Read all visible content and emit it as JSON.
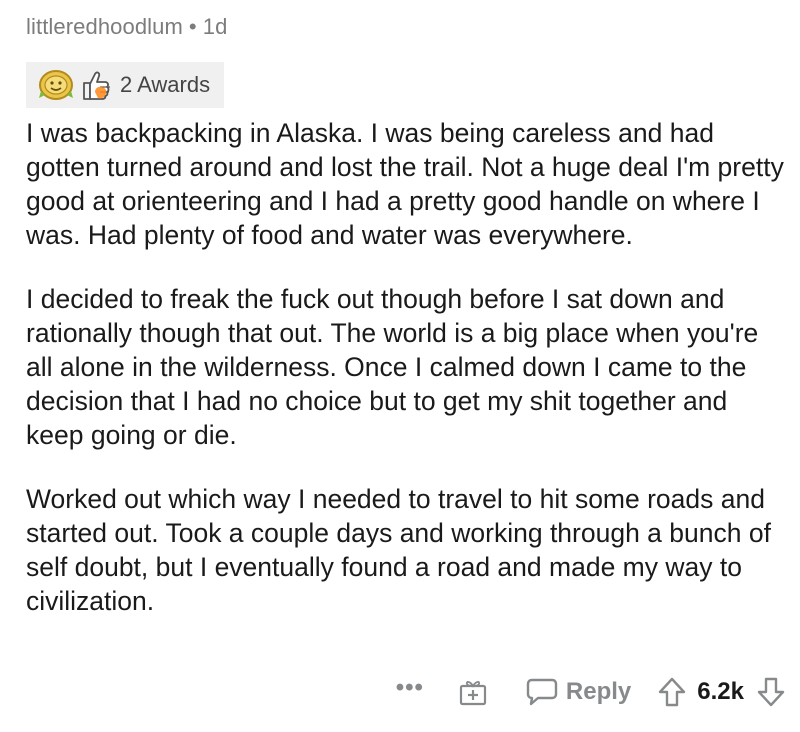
{
  "comment": {
    "username": "littleredhoodlum",
    "separator": "•",
    "age": "1d",
    "awards": {
      "count_label": "2 Awards",
      "icons": [
        "gold-coin-award-icon",
        "thumbs-up-award-icon"
      ]
    },
    "paragraphs": [
      "I was backpacking in Alaska. I was being careless and had gotten turned around and lost the trail. Not a huge deal I'm pretty good at orienteering and I had a pretty good handle on where I was. Had plenty of food and water was everywhere.",
      "I decided to freak the fuck out though before I sat down and rationally though that out. The world is a big place when you're all alone in the wilderness. Once I calmed down I came to the decision that I had no choice but to get my shit together and keep going or die.",
      "Worked out which way I needed to travel to hit some roads and started out. Took a couple days and working through a bunch of self doubt, but I eventually found a road and made my way to civilization."
    ],
    "actions": {
      "more_label": "•••",
      "reply_label": "Reply",
      "score": "6.2k"
    },
    "colors": {
      "meta_text": "#7c7c7c",
      "awards_bg": "#f0f0f0",
      "action_gray": "#878a8c",
      "body_text": "#1a1a1b"
    }
  }
}
